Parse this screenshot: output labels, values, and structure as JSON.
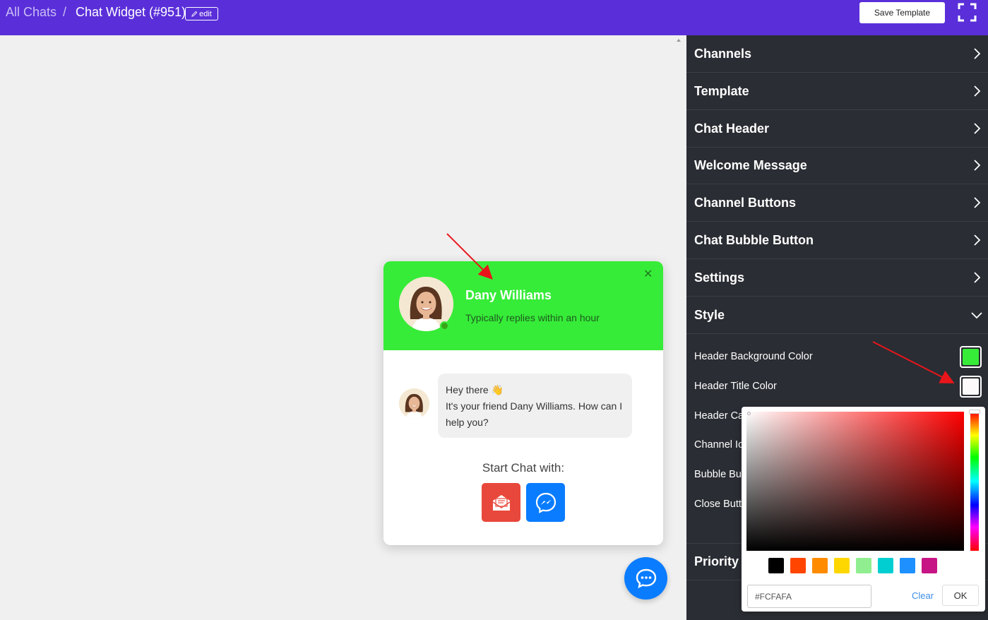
{
  "topbar": {
    "breadcrumb_root": "All Chats",
    "breadcrumb_separator": "/",
    "page_title": "Chat Widget (#951)",
    "edit_label": "edit",
    "save_label": "Save Template",
    "bg_color": "#5a2fd9"
  },
  "widget": {
    "header_bg": "#36ec38",
    "agent_name": "Dany Williams",
    "agent_subtitle": "Typically replies within an hour",
    "close_glyph": "✕",
    "message_line1": "Hey there 👋",
    "message_line2": "It's your friend Dany Williams. How can I help you?",
    "start_chat_label": "Start Chat with:",
    "channels": [
      {
        "name": "email",
        "icon": "email-icon",
        "color": "#e8483b"
      },
      {
        "name": "messenger",
        "icon": "messenger-icon",
        "color": "#0a7cff"
      }
    ],
    "fab_icon": "chat-bubble-icon"
  },
  "sidebar": {
    "sections": [
      {
        "label": "Channels",
        "expanded": false
      },
      {
        "label": "Template",
        "expanded": false
      },
      {
        "label": "Chat Header",
        "expanded": false
      },
      {
        "label": "Welcome Message",
        "expanded": false
      },
      {
        "label": "Channel Buttons",
        "expanded": false
      },
      {
        "label": "Chat Bubble Button",
        "expanded": false
      },
      {
        "label": "Settings",
        "expanded": false
      },
      {
        "label": "Style",
        "expanded": true
      }
    ],
    "style_rows": [
      {
        "label": "Header Background Color",
        "color": "#36ec38"
      },
      {
        "label": "Header Title Color",
        "color": "#FCFAFA"
      },
      {
        "label": "Header Ca",
        "color": ""
      },
      {
        "label": "Channel Ic",
        "color": ""
      },
      {
        "label": "Bubble Bu",
        "color": ""
      },
      {
        "label": "Close Butt",
        "color": ""
      }
    ],
    "priority_label": "Priority"
  },
  "color_picker": {
    "hex_value": "#FCFAFA",
    "clear_label": "Clear",
    "ok_label": "OK",
    "presets": [
      "#000000",
      "#ff4500",
      "#ff8c00",
      "#ffd700",
      "#90ee90",
      "#00ced1",
      "#1e90ff",
      "#c71585"
    ]
  }
}
